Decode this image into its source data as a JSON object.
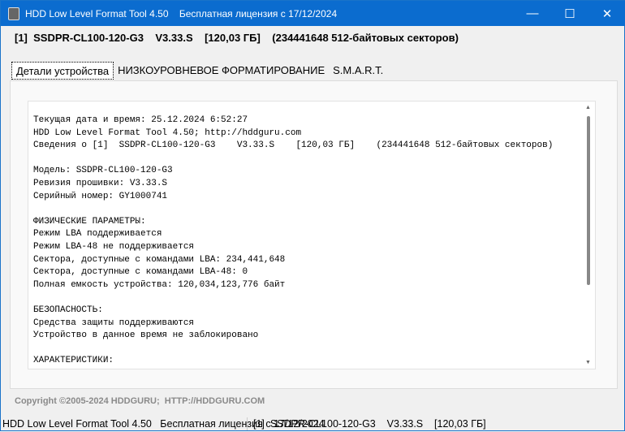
{
  "window": {
    "title": "HDD Low Level Format Tool 4.50    Бесплатная лицензия с 17/12/2024",
    "minimize": "—",
    "maximize": "☐",
    "close": "✕"
  },
  "device_line": "[1]  SSDPR-CL100-120-G3    V3.33.S    [120,03 ГБ]    (234441648 512-байтовых секторов)",
  "tabs": [
    {
      "label": "Детали устройства",
      "active": true
    },
    {
      "label": "НИЗКОУРОВНЕВОЕ ФОРМАТИРОВАНИЕ"
    },
    {
      "label": "S.M.A.R.T."
    }
  ],
  "details_text": "Текущая дата и время: 25.12.2024 6:52:27\nHDD Low Level Format Tool 4.50; http://hddguru.com\nСведения о [1]  SSDPR-CL100-120-G3    V3.33.S    [120,03 ГБ]    (234441648 512-байтовых секторов)\n\nМодель: SSDPR-CL100-120-G3\nРевизия прошивки: V3.33.S\nСерийный номер: GY1000741\n\nФИЗИЧЕСКИЕ ПАРАМЕТРЫ:\nРежим LBA поддерживается\nРежим LBA-48 не поддерживается\nСектора, доступные с командами LBA: 234,441,648\nСектора, доступные с командами LBA-48: 0\nПолная емкость устройства: 120,034,123,776 байт\n\nБЕЗОПАСНОСТЬ:\nСредства защиты поддерживаются\nУстройство в данное время не заблокировано\n\nХАРАКТЕРИСТИКИ:\nSMART поддерживается",
  "copyright": "Copyright ©2005-2024 HDDGURU;  HTTP://HDDGURU.COM",
  "status": {
    "left": "HDD Low Level Format Tool 4.50   Бесплатная лицензия с 17/12/2024",
    "right": "[1]  SSDPR-CL100-120-G3    V3.33.S    [120,03 ГБ]"
  }
}
